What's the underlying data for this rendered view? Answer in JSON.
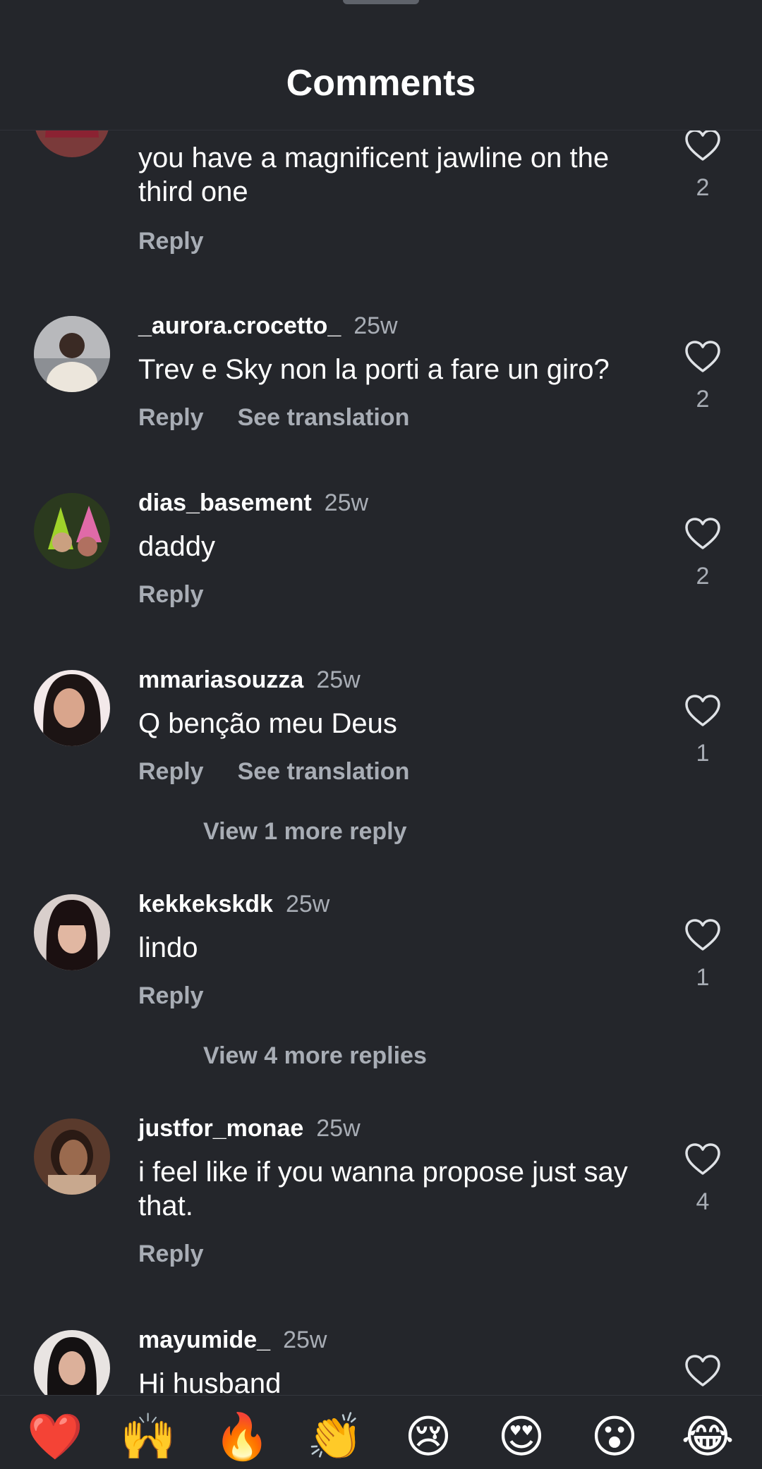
{
  "header": {
    "title": "Comments"
  },
  "comments": [
    {
      "username": "",
      "time": "",
      "text": "you have a magnificent jawline on the third one",
      "reply_label": "Reply",
      "translate_label": "",
      "likes": "2"
    },
    {
      "username": "_aurora.crocetto_",
      "time": "25w",
      "text": "Trev e Sky non la porti a fare un giro?",
      "reply_label": "Reply",
      "translate_label": "See translation",
      "likes": "2"
    },
    {
      "username": "dias_basement",
      "time": "25w",
      "text": "daddy",
      "reply_label": "Reply",
      "translate_label": "",
      "likes": "2"
    },
    {
      "username": "mmariasouzza",
      "time": "25w",
      "text": "Q benção meu Deus",
      "reply_label": "Reply",
      "translate_label": "See translation",
      "likes": "1",
      "view_more": "View 1 more reply"
    },
    {
      "username": "kekkekskdk",
      "time": "25w",
      "text": "lindo",
      "reply_label": "Reply",
      "translate_label": "",
      "likes": "1",
      "view_more": "View 4 more replies"
    },
    {
      "username": "justfor_monae",
      "time": "25w",
      "text": "i feel like if you wanna propose just say that.",
      "reply_label": "Reply",
      "translate_label": "",
      "likes": "4"
    },
    {
      "username": "mayumide_",
      "time": "25w",
      "text": "Hi husband",
      "reply_label": "",
      "translate_label": "",
      "likes": ""
    }
  ],
  "emoji_bar": [
    "❤️",
    "🙌",
    "🔥",
    "👏",
    "😢",
    "😍",
    "😮",
    "😂"
  ],
  "colors": {
    "background": "#24262b",
    "text": "#ffffff",
    "secondary": "#a8adb5"
  },
  "icons": {
    "like": "heart-outline-icon"
  }
}
